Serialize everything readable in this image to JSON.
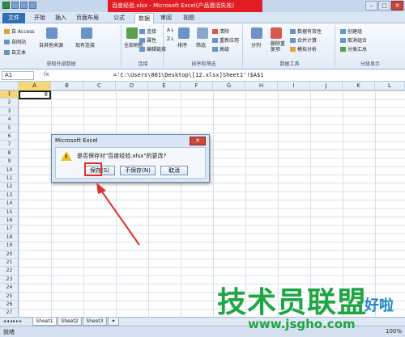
{
  "window": {
    "title": "百度经验.xlsx - Microsoft Excel(产品激活失败)"
  },
  "ribbon_tabs": [
    "文件",
    "开始",
    "插入",
    "页面布局",
    "公式",
    "数据",
    "审阅",
    "视图"
  ],
  "ribbon": {
    "access": "自 Access",
    "web": "自网站",
    "text": "自文本",
    "other_sources": "自其他来源",
    "existing_conn": "现有连接",
    "refresh_all": "全部刷新",
    "connections": "连接",
    "properties": "属性",
    "edit_links": "编辑链接",
    "sort": "排序",
    "filter": "筛选",
    "clear": "清除",
    "reapply": "重新应用",
    "advanced": "高级",
    "text_to_columns": "分列",
    "remove_duplicates": "删除重复项",
    "data_validation": "数据有效性",
    "consolidate": "合并计算",
    "what_if": "模拟分析",
    "group": "创建组",
    "ungroup": "取消组合",
    "subtotal": "分类汇总",
    "group_labels": {
      "get_external": "获取外部数据",
      "connections": "连接",
      "sort_filter": "排序和筛选",
      "data_tools": "数据工具",
      "outline": "分级显示"
    }
  },
  "formula_bar": {
    "name_box": "A1",
    "fx": "fx",
    "formula": "='C:\\Users\\001\\Desktop\\[12.xlsx]Sheet1'!$A$1"
  },
  "columns": [
    "A",
    "B",
    "C",
    "D",
    "E",
    "F",
    "G",
    "H",
    "I",
    "J",
    "K",
    "L"
  ],
  "rows": [
    "1",
    "2",
    "3",
    "4",
    "5",
    "6",
    "7",
    "8",
    "9",
    "10",
    "11",
    "12",
    "13",
    "14",
    "15",
    "16",
    "17",
    "18",
    "19",
    "20",
    "21",
    "22",
    "23",
    "24",
    "25",
    "26",
    "27"
  ],
  "cell_a1": "8",
  "sheets": [
    "Sheet1",
    "Sheet2",
    "Sheet3"
  ],
  "status": {
    "text": "就绪",
    "zoom": "100%"
  },
  "dialog": {
    "title": "Microsoft Excel",
    "close": "✕",
    "message": "是否保存对\"百度经验.xlsx\"的更改?",
    "save": "保存(S)",
    "dont_save": "不保存(N)",
    "cancel": "取消"
  },
  "watermark": {
    "main": "技术员联盟",
    "side": "好啦",
    "url": "www.jsgho.com"
  },
  "colors": {
    "highlight": "#e0302b",
    "tab_file": "#2f6fb5",
    "watermark_green": "#1da642"
  }
}
